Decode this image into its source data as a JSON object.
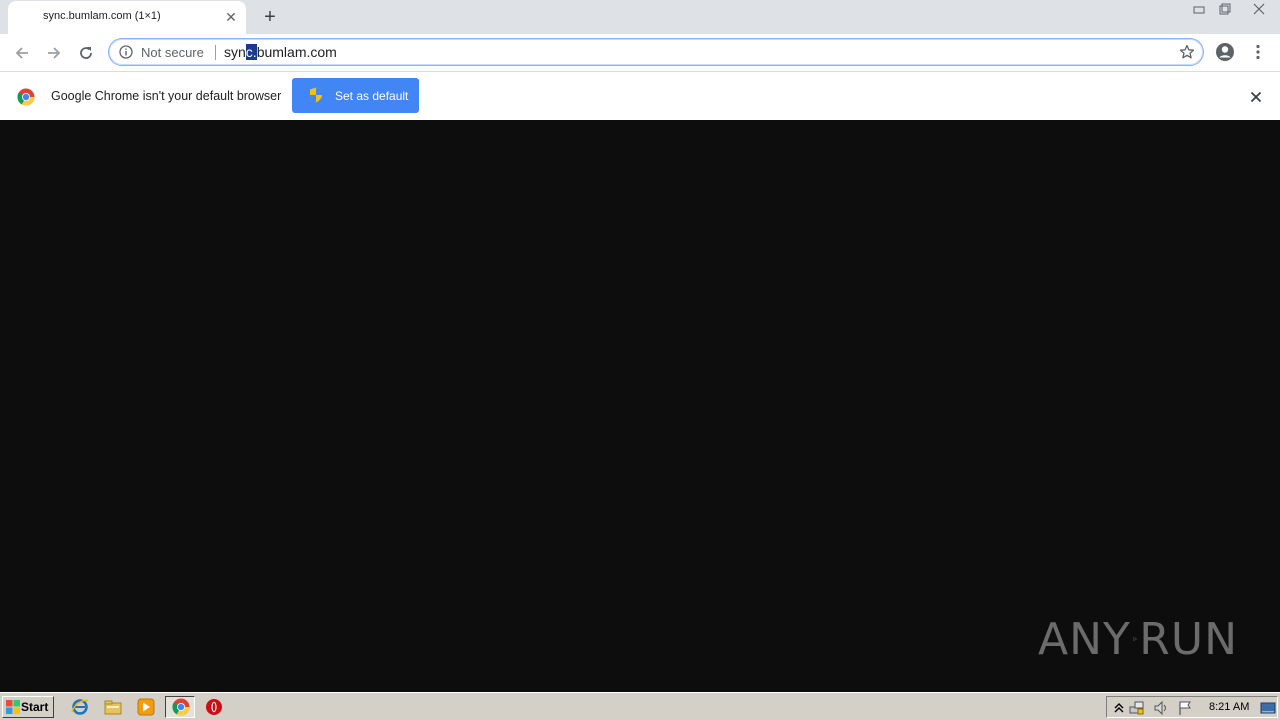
{
  "tab": {
    "title": "sync.bumlam.com (1×1)"
  },
  "omnibox": {
    "security_label": "Not secure",
    "url_before": "syn",
    "url_selected": "c.",
    "url_after": "bumlam.com"
  },
  "infobar": {
    "message": "Google Chrome isn't your default browser",
    "button_label": "Set as default"
  },
  "watermark": {
    "left": "ANY",
    "right": "RUN"
  },
  "taskbar": {
    "start_label": "Start",
    "clock": "8:21 AM"
  },
  "colors": {
    "accent": "#4285f4",
    "page_bg": "#0d0d0d",
    "tabstrip": "#dee1e6",
    "taskbar": "#d4d0c8"
  }
}
